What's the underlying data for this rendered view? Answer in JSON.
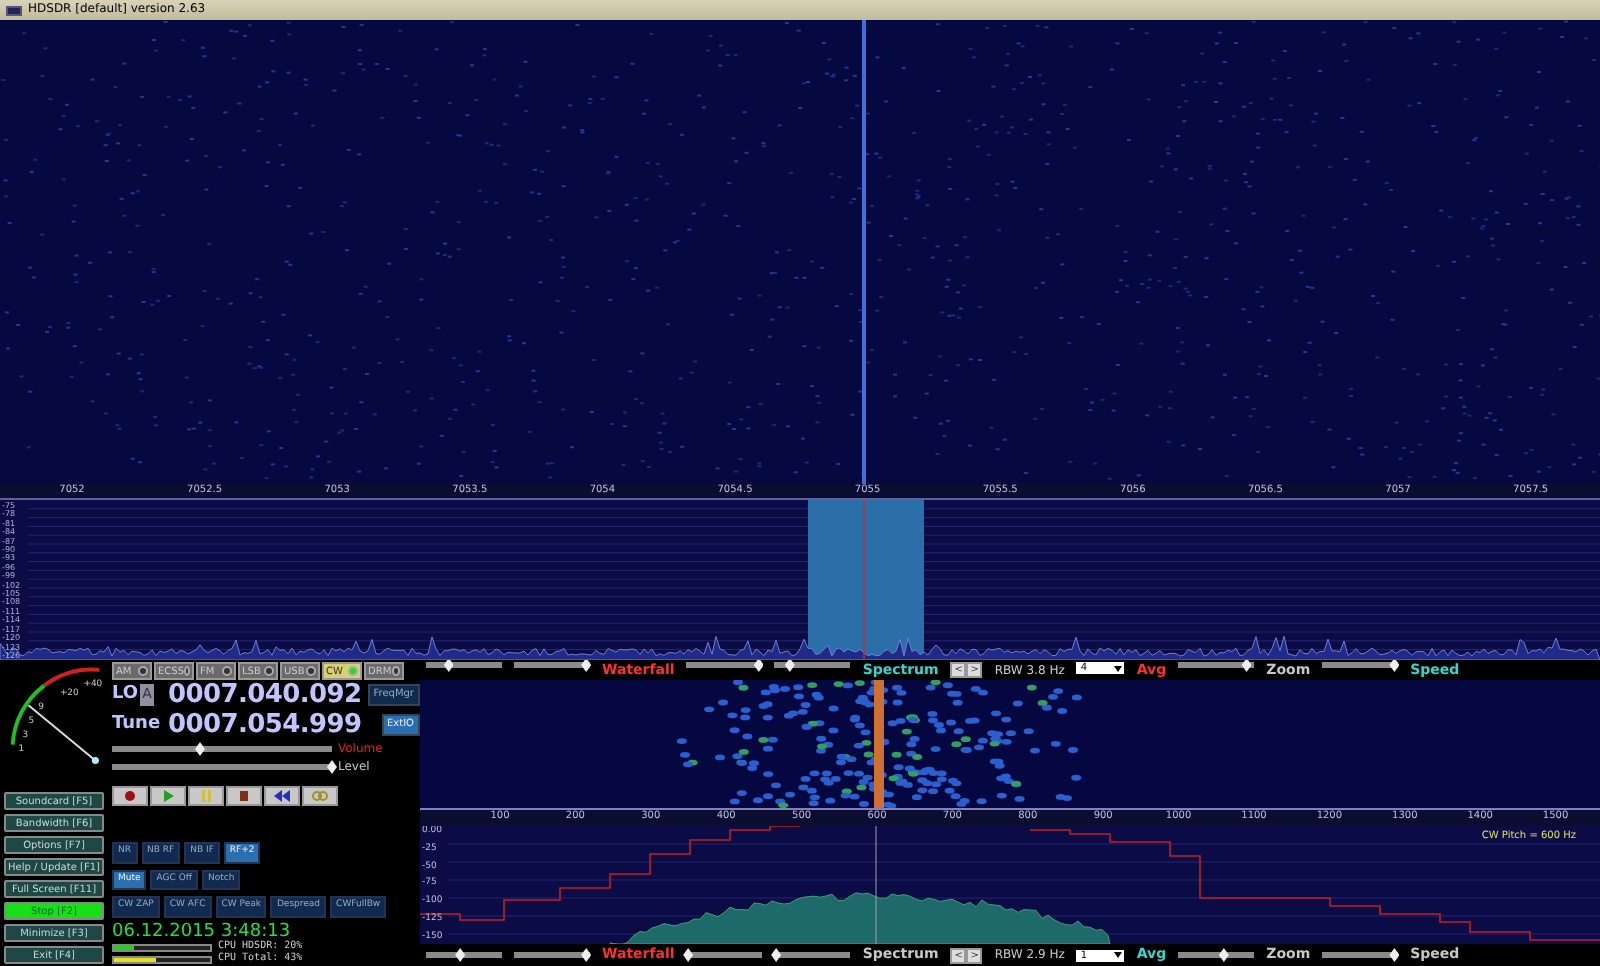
{
  "window": {
    "title": "HDSDR [default]  version 2.63"
  },
  "rf_ruler": {
    "labels": [
      "7052",
      "7052.5",
      "7053",
      "7053.5",
      "7054",
      "7054.5",
      "7055",
      "7055.5",
      "7056",
      "7056.5",
      "7057",
      "7057.5"
    ]
  },
  "rf_spectrum": {
    "db_labels": [
      "-75",
      "-78",
      "-81",
      "-84",
      "-87",
      "-90",
      "-93",
      "-96",
      "-99",
      "-102",
      "-105",
      "-108",
      "-111",
      "-114",
      "-117",
      "-120",
      "-123",
      "-126"
    ]
  },
  "modes": [
    {
      "label": "AM",
      "selected": false
    },
    {
      "label": "ECSS",
      "selected": false
    },
    {
      "label": "FM",
      "selected": false
    },
    {
      "label": "LSB",
      "selected": false
    },
    {
      "label": "USB",
      "selected": false
    },
    {
      "label": "CW",
      "selected": true
    },
    {
      "label": "DRM",
      "selected": false
    }
  ],
  "s_meter": {
    "labels": [
      "+40",
      "+20",
      "9",
      "5",
      "3",
      "1"
    ]
  },
  "lo": {
    "label": "LO",
    "marker": "A",
    "value": "0007.040.092"
  },
  "tune": {
    "label": "Tune",
    "value": "0007.054.999"
  },
  "side_buttons": [
    {
      "label": "FreqMgr",
      "selected": false
    },
    {
      "label": "ExtIO",
      "selected": true
    }
  ],
  "sliders": [
    {
      "label": "Volume",
      "level": 0.4,
      "color": "#e02020"
    },
    {
      "label": "Level",
      "level": 1.0,
      "color": "#c8c8c8"
    }
  ],
  "transport": [
    {
      "kind": "record"
    },
    {
      "kind": "play"
    },
    {
      "kind": "pause"
    },
    {
      "kind": "stop"
    },
    {
      "kind": "rewind"
    },
    {
      "kind": "loop"
    }
  ],
  "function_keys": [
    {
      "label": "Soundcard [F5]",
      "selected": false
    },
    {
      "label": "Bandwidth [F6]",
      "selected": false
    },
    {
      "label": "Options  [F7]",
      "selected": false
    },
    {
      "label": "Help / Update  [F1]",
      "selected": false
    },
    {
      "label": "Full Screen  [F11]",
      "selected": false
    },
    {
      "label": "Stop  [F2]",
      "selected": true
    },
    {
      "label": "Minimize  [F3]",
      "selected": false
    },
    {
      "label": "Exit  [F4]",
      "selected": false
    }
  ],
  "dsp_rows": [
    [
      {
        "label": "NR",
        "selected": false
      },
      {
        "label": "NB RF",
        "selected": false
      },
      {
        "label": "NB IF",
        "selected": false
      },
      {
        "label": "RF+2",
        "selected": true
      }
    ],
    [
      {
        "label": "Mute",
        "selected": true
      },
      {
        "label": "AGC Off",
        "selected": false
      },
      {
        "label": "Notch",
        "selected": false
      }
    ],
    [
      {
        "label": "CW ZAP",
        "selected": false
      },
      {
        "label": "CW AFC",
        "selected": false
      },
      {
        "label": "CW Peak",
        "selected": false
      },
      {
        "label": "Despread",
        "selected": false
      },
      {
        "label": "CWFullBw",
        "selected": false
      }
    ]
  ],
  "clock": "06.12.2015 3:48:13",
  "cpu": [
    {
      "label": "CPU HDSDR:",
      "value": "20%",
      "level": 0.2
    },
    {
      "label": "CPU Total:",
      "value": "43%",
      "level": 0.43
    }
  ],
  "toolbars": [
    [
      {
        "kind": "slider",
        "level": 0.3
      },
      {
        "kind": "slider",
        "level": 0.95
      },
      {
        "kind": "label",
        "text": "Waterfall",
        "color": "#ff3030"
      },
      {
        "kind": "slider",
        "level": 0.95
      },
      {
        "kind": "slider",
        "level": 0.2
      },
      {
        "kind": "label",
        "text": "Spectrum",
        "color": "#30d8d0"
      },
      {
        "kind": "stepper",
        "left": "<",
        "right": ">"
      },
      {
        "kind": "text",
        "text": "RBW  3.8 Hz"
      },
      {
        "kind": "select",
        "value": "4"
      },
      {
        "kind": "label",
        "text": "Avg",
        "color": "#ff3030"
      },
      {
        "kind": "slider",
        "level": 0.9
      },
      {
        "kind": "label",
        "text": "Zoom",
        "color": "#c8c8c8"
      },
      {
        "kind": "slider",
        "level": 0.95
      },
      {
        "kind": "label",
        "text": "Speed",
        "color": "#30d8d0"
      }
    ],
    [
      {
        "kind": "slider",
        "level": 0.45
      },
      {
        "kind": "slider",
        "level": 0.95
      },
      {
        "kind": "label",
        "text": "Waterfall",
        "color": "#ff3030"
      },
      {
        "kind": "slider",
        "level": 0.02
      },
      {
        "kind": "slider",
        "level": 0.02
      },
      {
        "kind": "label",
        "text": "Spectrum",
        "color": "#c8c8c8"
      },
      {
        "kind": "stepper",
        "left": "<",
        "right": ">"
      },
      {
        "kind": "text",
        "text": "RBW  2.9 Hz"
      },
      {
        "kind": "select",
        "value": "1"
      },
      {
        "kind": "label",
        "text": "Avg",
        "color": "#30d8d0"
      },
      {
        "kind": "slider",
        "level": 0.6
      },
      {
        "kind": "label",
        "text": "Zoom",
        "color": "#c8c8c8"
      },
      {
        "kind": "slider",
        "level": 0.95
      },
      {
        "kind": "label",
        "text": "Speed",
        "color": "#c8c8c8"
      }
    ]
  ],
  "audio_ruler": {
    "labels": [
      "100",
      "200",
      "300",
      "400",
      "500",
      "600",
      "700",
      "800",
      "900",
      "1000",
      "1100",
      "1200",
      "1300",
      "1400",
      "1500"
    ]
  },
  "audio_spectrum": {
    "db_labels": [
      "0.00",
      "-25",
      "-50",
      "-75",
      "-100",
      "-125",
      "-150"
    ],
    "note": "CW Pitch = 600 Hz"
  }
}
